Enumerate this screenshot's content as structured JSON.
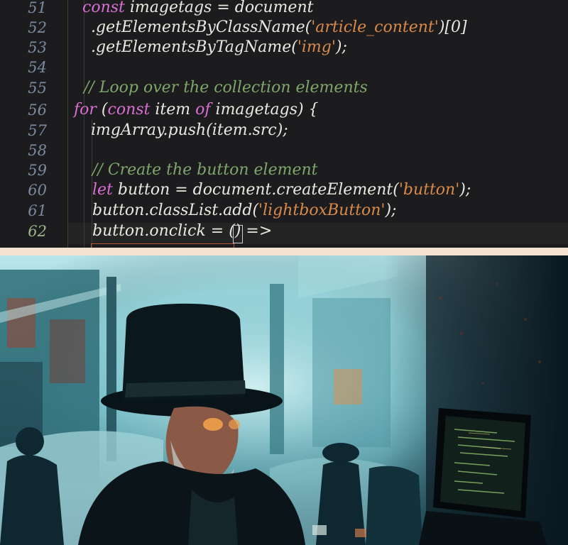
{
  "editor": {
    "lines": [
      {
        "num": "51",
        "text": "const imagetags = document",
        "kind": "plain"
      },
      {
        "num": "52",
        "text": ".getElementsByClassName('article_content')[0]",
        "kind": "plain"
      },
      {
        "num": "53",
        "text": ".getElementsByTagName('img');",
        "kind": "plain"
      },
      {
        "num": "54",
        "text": "",
        "kind": "plain"
      },
      {
        "num": "55",
        "text": "// Loop over the collection elements",
        "kind": "comment"
      },
      {
        "num": "56",
        "text": "for (const item of imagetags) {",
        "kind": "plain"
      },
      {
        "num": "57",
        "text": "imgArray.push(item.src);",
        "kind": "plain"
      },
      {
        "num": "58",
        "text": "",
        "kind": "plain"
      },
      {
        "num": "59",
        "text": "// Create the button element",
        "kind": "comment"
      },
      {
        "num": "60",
        "text": "let button = document.createElement('button');",
        "kind": "plain"
      },
      {
        "num": "61",
        "text": "button.classList.add('lightboxButton');",
        "kind": "plain"
      },
      {
        "num": "62",
        "text": "button.onclick = () =>",
        "kind": "plain"
      }
    ]
  },
  "colors": {
    "editor_bg": "#1c1c1e",
    "separator": "#f3e3cf",
    "keyword": "#d96fd3",
    "comment": "#7ea66a",
    "string": "#d88a4a",
    "line_number": "#7b8a9e"
  },
  "painting": {
    "subject": "top-hat-figure-with-laptop"
  }
}
